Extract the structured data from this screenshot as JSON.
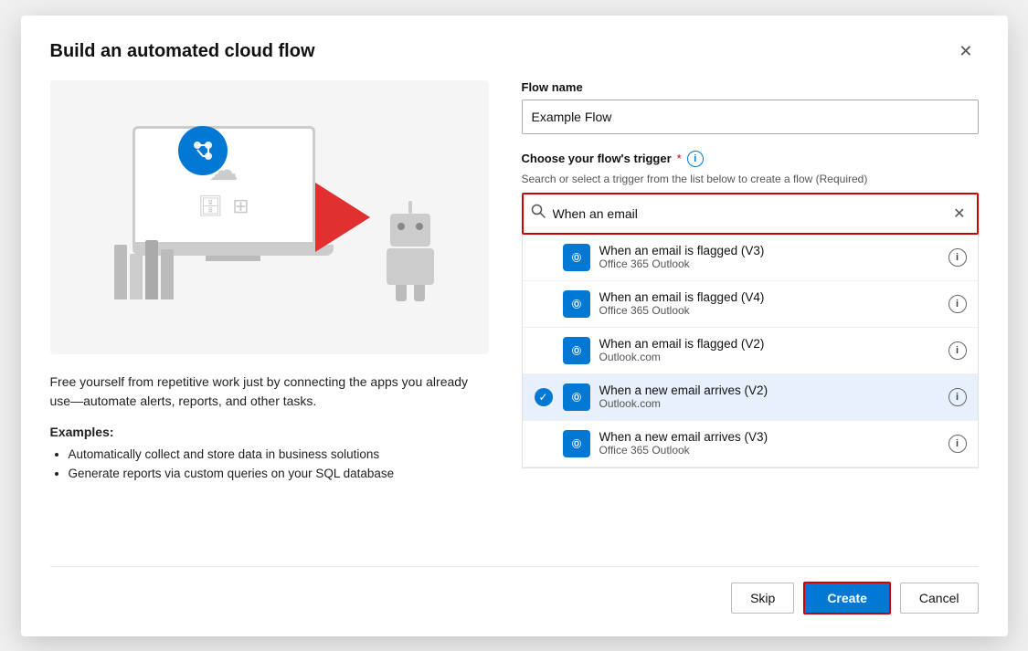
{
  "dialog": {
    "title": "Build an automated cloud flow",
    "close_label": "✕"
  },
  "left": {
    "description": "Free yourself from repetitive work just by connecting the apps you already use—automate alerts, reports, and other tasks.",
    "examples_title": "Examples:",
    "examples": [
      "Automatically collect and store data in business solutions",
      "Generate reports via custom queries on your SQL database"
    ]
  },
  "right": {
    "flow_name_label": "Flow name",
    "flow_name_value": "Example Flow",
    "trigger_label": "Choose your flow's trigger",
    "required_indicator": "*",
    "hint_text": "Search or select a trigger from the list below to create a flow (Required)",
    "search_placeholder": "When an email",
    "search_value": "When an email",
    "triggers": [
      {
        "id": 1,
        "name": "When an email is flagged (V3)",
        "app": "Office 365 Outlook",
        "selected": false
      },
      {
        "id": 2,
        "name": "When an email is flagged (V4)",
        "app": "Office 365 Outlook",
        "selected": false
      },
      {
        "id": 3,
        "name": "When an email is flagged (V2)",
        "app": "Outlook.com",
        "selected": false
      },
      {
        "id": 4,
        "name": "When a new email arrives (V2)",
        "app": "Outlook.com",
        "selected": true
      },
      {
        "id": 5,
        "name": "When a new email arrives (V3)",
        "app": "Office 365 Outlook",
        "selected": false
      }
    ]
  },
  "footer": {
    "skip_label": "Skip",
    "create_label": "Create",
    "cancel_label": "Cancel"
  },
  "icons": {
    "close": "✕",
    "search": "🔍",
    "clear": "✕",
    "info": "i",
    "check": "✓",
    "outlook": "Ⓞ"
  }
}
